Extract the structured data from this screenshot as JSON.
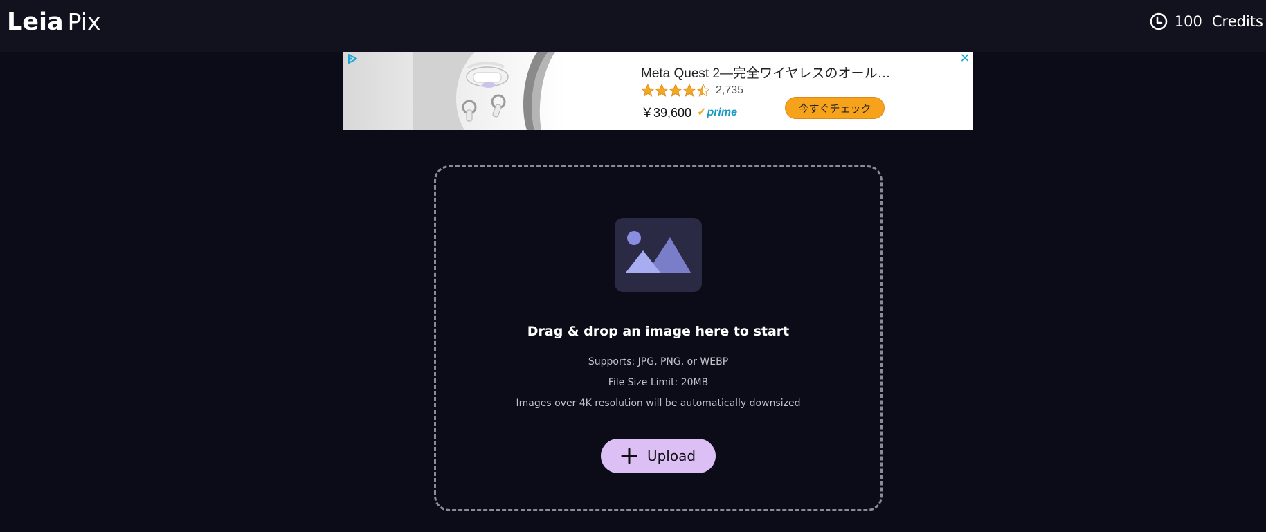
{
  "header": {
    "logo_primary": "Leia",
    "logo_secondary": "Pix",
    "credits_value": "100",
    "credits_label": "Credits",
    "icons": {
      "credits": "clock-coin-icon"
    }
  },
  "ad": {
    "title": "Meta Quest 2—完全ワイヤレスのオール…",
    "rating_count": "2,735",
    "rating_stars": 4.5,
    "price": "￥39,600",
    "prime_check": "✓",
    "prime_label": "prime",
    "cta_label": "今すぐチェック",
    "close_glyph": "✕",
    "icons": {
      "badge": "ad-choices-icon",
      "close": "close-icon",
      "product": "vr-headset-image"
    },
    "colors": {
      "cta": "#f7a21b",
      "prime": "#1a98c4",
      "close": "#1ea7d9"
    }
  },
  "dropzone": {
    "title": "Drag & drop an image here to start",
    "supports": "Supports: JPG, PNG, or WEBP",
    "size_limit": "File Size Limit: 20MB",
    "resolution_note": "Images over 4K resolution will be automatically downsized",
    "upload_label": "Upload",
    "icons": {
      "placeholder": "image-placeholder-icon",
      "upload": "plus-icon"
    }
  },
  "colors": {
    "background": "#0c0c18",
    "header": "#12121e",
    "accent": "#dcc0f5",
    "placeholder_tile": "#2a2a44",
    "placeholder_art": "#8a8ee0"
  }
}
